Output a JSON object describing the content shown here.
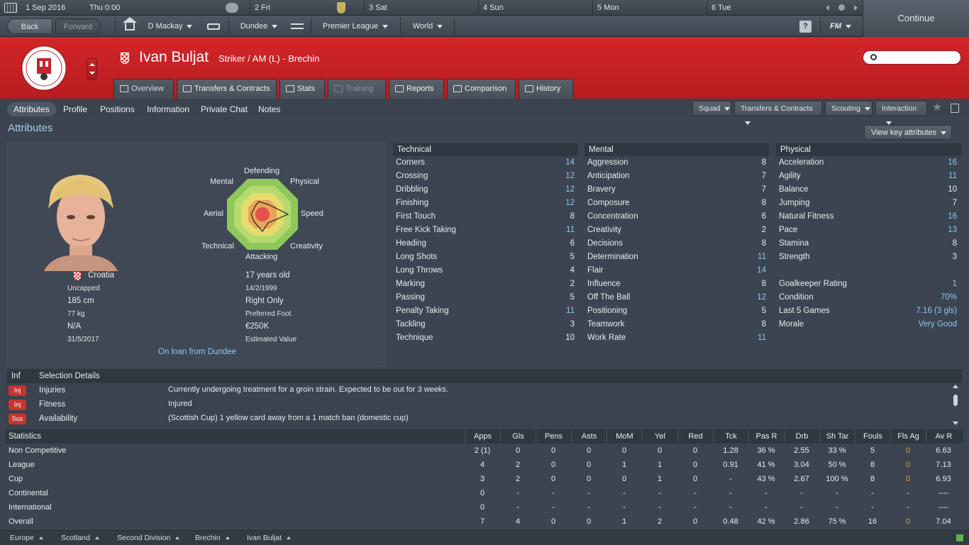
{
  "calendar": {
    "date": "1 Sep 2016",
    "time": "Thu 0:00",
    "days": [
      "2 Fri",
      "3 Sat",
      "4 Sun",
      "5 Mon",
      "6 Tue"
    ],
    "continue_label": "Continue"
  },
  "nav": {
    "back": "Back",
    "forward": "Forward",
    "manager": "D Mackay",
    "club": "Dundee",
    "league": "Premier League",
    "world": "World",
    "help": "?",
    "fm": "FM"
  },
  "player": {
    "name": "Ivan Buljat",
    "position": "Striker / AM (L) - Brechin",
    "club_badge_text": "BRECHIN CITY FOOTBALL CLUB",
    "club_badge_year": "1906"
  },
  "tabs": [
    "Overview",
    "Transfers & Contracts",
    "Stats",
    "Training",
    "Reports",
    "Comparison",
    "History"
  ],
  "subtabs": [
    "Attributes",
    "Profile",
    "Positions",
    "Information",
    "Private Chat",
    "Notes"
  ],
  "actions": [
    "Squad",
    "Transfers & Contracts",
    "Scouting",
    "Interaction"
  ],
  "section_title": "Attributes",
  "view_key_attributes": "View key attributes",
  "radar": {
    "labels": [
      "Defending",
      "Physical",
      "Speed",
      "Creativity",
      "Attacking",
      "Technical",
      "Aerial",
      "Mental"
    ]
  },
  "bio": {
    "nation": "Croatia",
    "caps": "Uncapped",
    "age": "17 years old",
    "dob": "14/2/1999",
    "height": "185 cm",
    "foot": "Right Only",
    "weight": "77 kg",
    "foot_label": "Preferred Foot",
    "wage": "N/A",
    "value": "€250K",
    "contract": "31/5/2017",
    "value_label": "Estimated Value",
    "loan": "On loan from Dundee"
  },
  "technical": {
    "title": "Technical",
    "items": [
      {
        "n": "Corners",
        "v": "14"
      },
      {
        "n": "Crossing",
        "v": "12"
      },
      {
        "n": "Dribbling",
        "v": "12"
      },
      {
        "n": "Finishing",
        "v": "12"
      },
      {
        "n": "First Touch",
        "v": "8"
      },
      {
        "n": "Free Kick Taking",
        "v": "11"
      },
      {
        "n": "Heading",
        "v": "6"
      },
      {
        "n": "Long Shots",
        "v": "5"
      },
      {
        "n": "Long Throws",
        "v": "4"
      },
      {
        "n": "Marking",
        "v": "2"
      },
      {
        "n": "Passing",
        "v": "5"
      },
      {
        "n": "Penalty Taking",
        "v": "11"
      },
      {
        "n": "Tackling",
        "v": "3"
      },
      {
        "n": "Technique",
        "v": "10"
      }
    ]
  },
  "mental": {
    "title": "Mental",
    "items": [
      {
        "n": "Aggression",
        "v": "8"
      },
      {
        "n": "Anticipation",
        "v": "7"
      },
      {
        "n": "Bravery",
        "v": "7"
      },
      {
        "n": "Composure",
        "v": "8"
      },
      {
        "n": "Concentration",
        "v": "6"
      },
      {
        "n": "Creativity",
        "v": "2"
      },
      {
        "n": "Decisions",
        "v": "8"
      },
      {
        "n": "Determination",
        "v": "11"
      },
      {
        "n": "Flair",
        "v": "14"
      },
      {
        "n": "Influence",
        "v": "8"
      },
      {
        "n": "Off The Ball",
        "v": "12"
      },
      {
        "n": "Positioning",
        "v": "5"
      },
      {
        "n": "Teamwork",
        "v": "8"
      },
      {
        "n": "Work Rate",
        "v": "11"
      }
    ]
  },
  "physical": {
    "title": "Physical",
    "items": [
      {
        "n": "Acceleration",
        "v": "16"
      },
      {
        "n": "Agility",
        "v": "11"
      },
      {
        "n": "Balance",
        "v": "10"
      },
      {
        "n": "Jumping",
        "v": "7"
      },
      {
        "n": "Natural Fitness",
        "v": "16"
      },
      {
        "n": "Pace",
        "v": "13"
      },
      {
        "n": "Stamina",
        "v": "8"
      },
      {
        "n": "Strength",
        "v": "3"
      }
    ],
    "extra": [
      {
        "n": "Goalkeeper Rating",
        "v": "1"
      },
      {
        "n": "Condition",
        "v": "70%"
      },
      {
        "n": "Last 5 Games",
        "v": "7.16 (3 gls)"
      },
      {
        "n": "Morale",
        "v": "Very Good"
      }
    ]
  },
  "selection": {
    "head_inf": "Inf",
    "head_title": "Selection Details",
    "rows": [
      {
        "badge": "Inj",
        "label": "Injuries",
        "detail": "Currently undergoing treatment for a groin strain. Expected to be out for 3 weeks."
      },
      {
        "badge": "Inj",
        "label": "Fitness",
        "detail": "Injured"
      },
      {
        "badge": "Sus",
        "label": "Availability",
        "detail": "(Scottish Cup) 1 yellow card away from a 1 match ban (domestic cup)"
      }
    ]
  },
  "statistics": {
    "title": "Statistics",
    "columns": [
      "Apps",
      "Gls",
      "Pens",
      "Asts",
      "MoM",
      "Yel",
      "Red",
      "Tck",
      "Pas R",
      "Drb",
      "Sh Tar",
      "Fouls",
      "Fls Ag",
      "Av R"
    ],
    "rows": [
      {
        "label": "Non Competitive",
        "cells": [
          "2 (1)",
          "0",
          "0",
          "0",
          "0",
          "0",
          "0",
          "1.28",
          "36 %",
          "2.55",
          "33 %",
          "5",
          "0",
          "6.63"
        ]
      },
      {
        "label": "League",
        "cells": [
          "4",
          "2",
          "0",
          "0",
          "1",
          "1",
          "0",
          "0.91",
          "41 %",
          "3.04",
          "50 %",
          "8",
          "0",
          "7.13"
        ]
      },
      {
        "label": "Cup",
        "cells": [
          "3",
          "2",
          "0",
          "0",
          "0",
          "1",
          "0",
          "-",
          "43 %",
          "2.67",
          "100 %",
          "8",
          "0",
          "6.93"
        ]
      },
      {
        "label": "Continental",
        "cells": [
          "0",
          "-",
          "-",
          "-",
          "-",
          "-",
          "-",
          "-",
          "-",
          "-",
          "-",
          "-",
          "-",
          "----"
        ]
      },
      {
        "label": "International",
        "cells": [
          "0",
          "-",
          "-",
          "-",
          "-",
          "-",
          "-",
          "-",
          "-",
          "-",
          "-",
          "-",
          "-",
          "----"
        ]
      },
      {
        "label": "Overall",
        "cells": [
          "7",
          "4",
          "0",
          "0",
          "1",
          "2",
          "0",
          "0.48",
          "42 %",
          "2.86",
          "75 %",
          "16",
          "0",
          "7.04"
        ]
      }
    ]
  },
  "breadcrumbs": [
    "Europe",
    "Scotland",
    "Second Division",
    "Brechin",
    "Ivan Buljat"
  ]
}
